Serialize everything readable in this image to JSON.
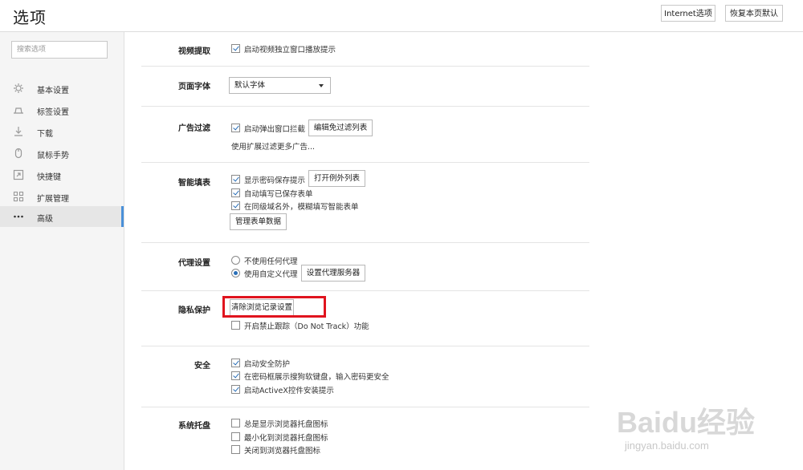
{
  "header": {
    "title": "选项",
    "internet_options": "Internet选项",
    "restore_default": "恢复本页默认"
  },
  "sidebar": {
    "search_placeholder": "搜索选项",
    "items": [
      {
        "label": "基本设置",
        "icon": "gear-icon"
      },
      {
        "label": "标签设置",
        "icon": "tab-icon"
      },
      {
        "label": "下载",
        "icon": "download-icon"
      },
      {
        "label": "鼠标手势",
        "icon": "mouse-icon"
      },
      {
        "label": "快捷键",
        "icon": "shortcut-icon"
      },
      {
        "label": "扩展管理",
        "icon": "extensions-icon"
      },
      {
        "label": "高级",
        "icon": "more-icon"
      }
    ],
    "active_index": 6
  },
  "sections": {
    "video": {
      "label": "视频提取",
      "opt1": "启动视频独立窗口播放提示"
    },
    "font": {
      "label": "页面字体",
      "selected": "默认字体"
    },
    "adblock": {
      "label": "广告过滤",
      "opt1": "启动弹出窗口拦截",
      "edit_btn": "编辑免过滤列表",
      "note": "使用扩展过滤更多广告..."
    },
    "autofill": {
      "label": "智能填表",
      "opt1": "显示密码保存提示",
      "exceptions_btn": "打开例外列表",
      "opt2": "自动填写已保存表单",
      "opt3": "在同级域名外，模糊填写智能表单",
      "manage_btn": "管理表单数据"
    },
    "proxy": {
      "label": "代理设置",
      "opt1": "不使用任何代理",
      "opt2": "使用自定义代理",
      "server_btn": "设置代理服务器"
    },
    "privacy": {
      "label": "隐私保护",
      "clear_btn": "清除浏览记录设置",
      "dnt": "开启禁止跟踪（Do Not Track）功能"
    },
    "security": {
      "label": "安全",
      "opt1": "启动安全防护",
      "opt2": "在密码框展示搜狗软键盘，输入密码更安全",
      "opt3": "启动ActiveX控件安装提示"
    },
    "tray": {
      "label": "系统托盘",
      "opt1": "总是显示浏览器托盘图标",
      "opt2": "最小化到浏览器托盘图标",
      "opt3": "关闭到浏览器托盘图标"
    }
  },
  "watermark": {
    "big": "Baidu经验",
    "small": "jingyan.baidu.com"
  },
  "colors": {
    "accent": "#4a90d9",
    "highlight": "#e0141e"
  }
}
